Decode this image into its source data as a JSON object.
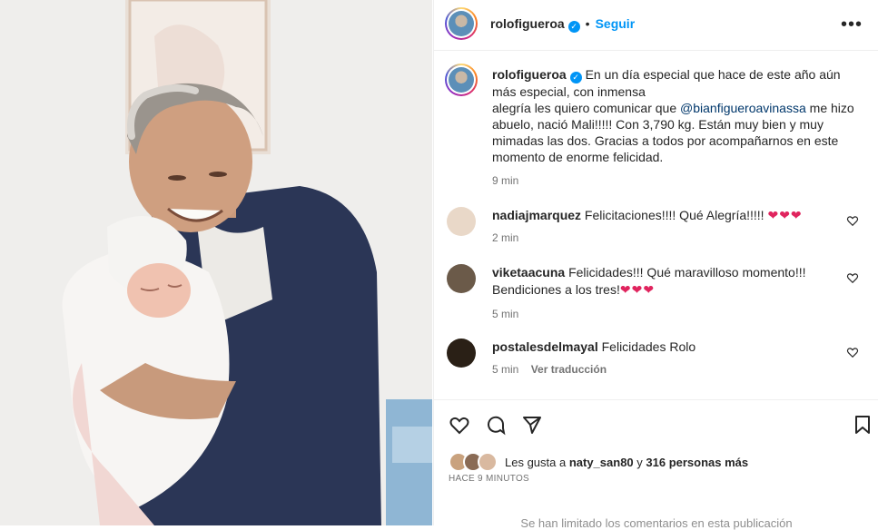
{
  "post_author": {
    "username": "rolofigueroa",
    "follow_label": "Seguir",
    "separator": "•",
    "more_label": "•••"
  },
  "caption": {
    "username": "rolofigueroa",
    "line1": "En un día especial que hace de este año aún más especial, con inmensa",
    "line2a": "alegría les quiero comunicar que ",
    "mention": "@bianfigueroavinassa",
    "line2b": " me hizo abuelo, nació Mali!!!!! Con 3,790 kg. Están muy bien y muy mimadas las dos. Gracias a todos por acompañarnos en este momento de enorme felicidad.",
    "time": "9 min"
  },
  "comments": [
    {
      "username": "nadiajmarquez",
      "text": "Felicitaciones!!!! Qué Alegría!!!!!",
      "hearts": "❤❤❤",
      "time": "2 min",
      "avatar_color": "#e9d8c8"
    },
    {
      "username": "viketaacuna",
      "text": "Felicidades!!! Qué maravilloso momento!!! Bendiciones a los tres!",
      "hearts": "❤❤❤",
      "time": "5 min",
      "avatar_color": "#6b5a49"
    },
    {
      "username": "postalesdelmayal",
      "text": "Felicidades Rolo",
      "hearts": "",
      "time": "5 min",
      "translate": "Ver traducción",
      "avatar_color": "#2a2016"
    }
  ],
  "likes": {
    "prefix": "Les gusta a ",
    "user": "naty_san80",
    "middle": " y ",
    "others": "316 personas más",
    "time_caps": "HACE 9 MINUTOS"
  },
  "footer_notice": "Se han limitado los comentarios en esta publicación",
  "icons": [
    "heart-icon",
    "comment-icon",
    "share-icon",
    "bookmark-icon",
    "more-options-icon",
    "verified-badge-icon"
  ]
}
